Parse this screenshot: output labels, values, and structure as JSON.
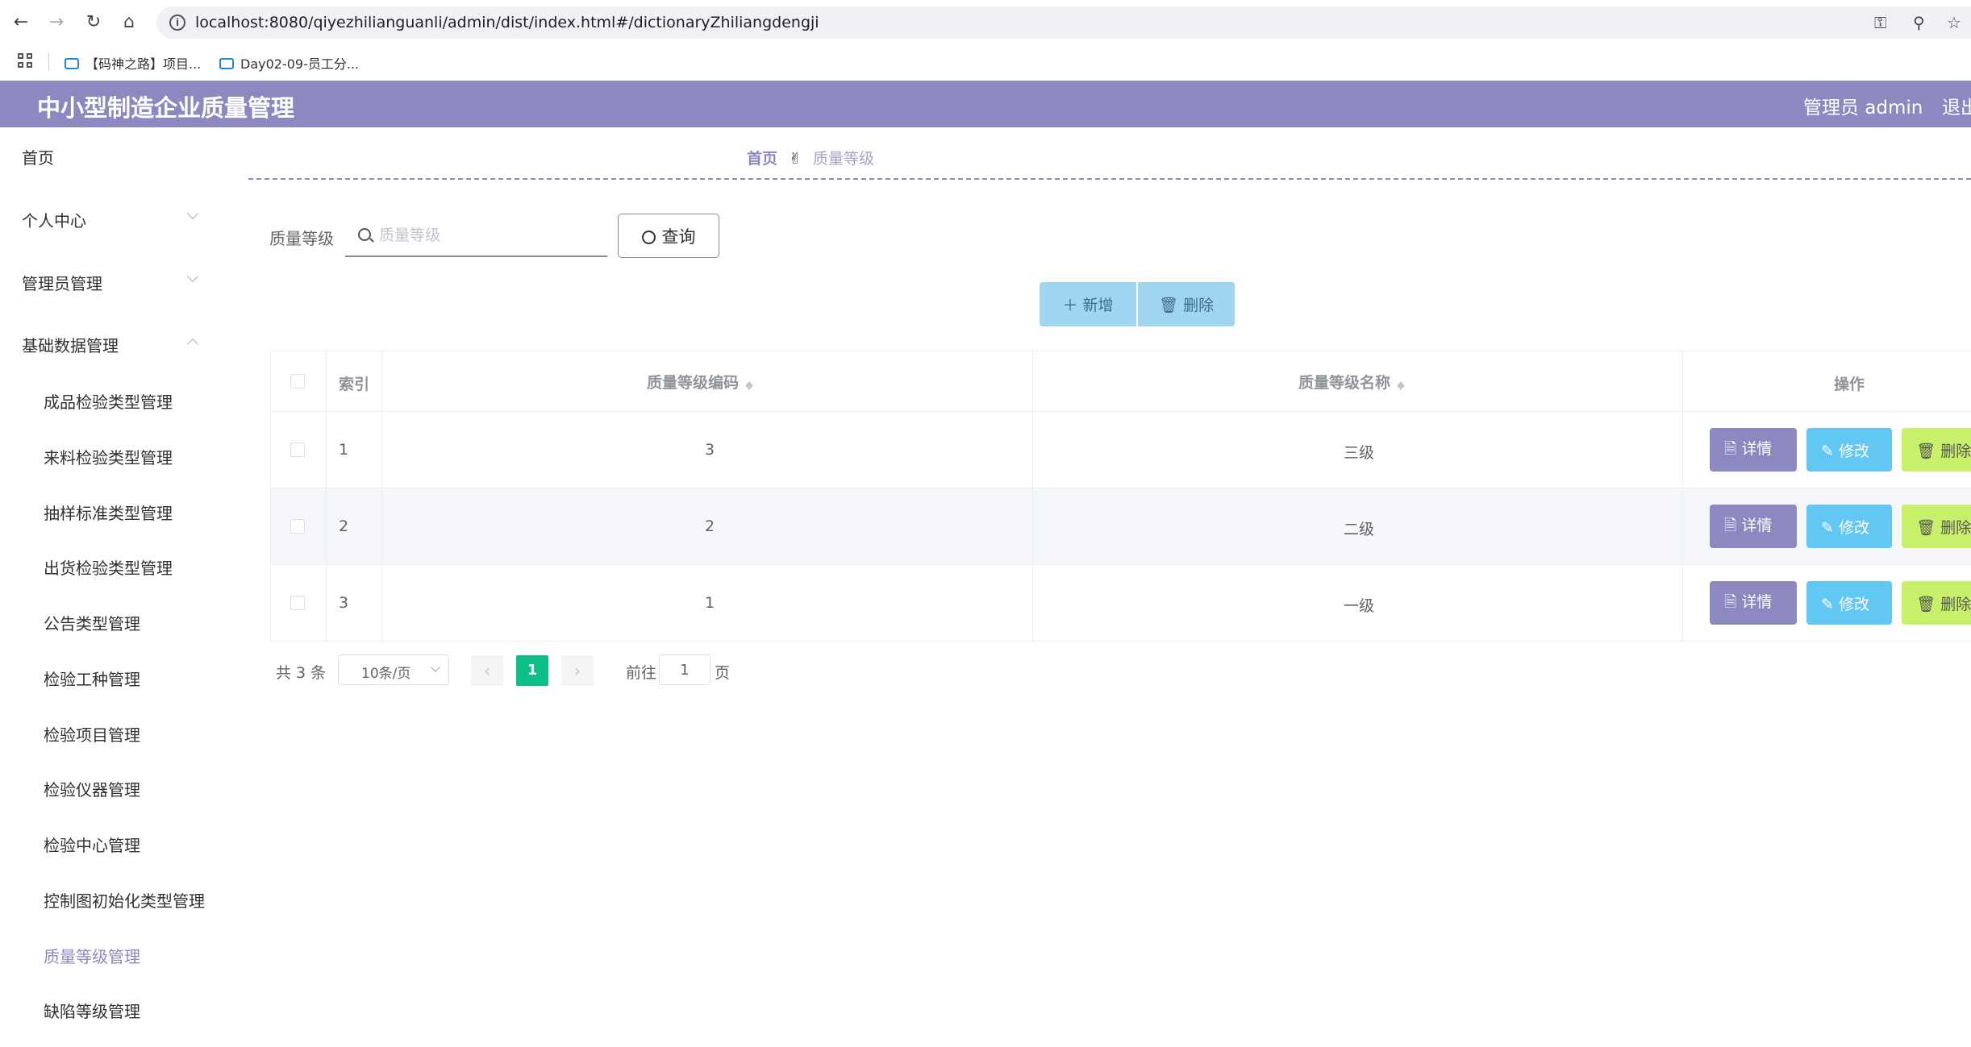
{
  "browser": {
    "url": "localhost:8080/qiyezhilianguanli/admin/dist/index.html#/dictionaryZhiliangdengji",
    "bookmarks": [
      "【码神之路】项目...",
      "Day02-09-员工分..."
    ]
  },
  "header": {
    "title": "中小型制造企业质量管理",
    "admin": "管理员 admin",
    "logout": "退出"
  },
  "sidebar": {
    "home": "首页",
    "groups": [
      {
        "label": "个人中心",
        "expanded": false
      },
      {
        "label": "管理员管理",
        "expanded": false
      },
      {
        "label": "基础数据管理",
        "expanded": true
      }
    ],
    "items": [
      "成品检验类型管理",
      "来料检验类型管理",
      "抽样标准类型管理",
      "出货检验类型管理",
      "公告类型管理",
      "检验工种管理",
      "检验项目管理",
      "检验仪器管理",
      "检验中心管理",
      "控制图初始化类型管理",
      "质量等级管理",
      "缺陷等级管理"
    ],
    "active_item": "质量等级管理"
  },
  "breadcrumb": {
    "home": "首页",
    "separator_icon": "hand-icon",
    "current": "质量等级"
  },
  "search": {
    "label": "质量等级",
    "placeholder": "质量等级",
    "value": "",
    "button": "查询"
  },
  "actions": {
    "add": "＋ 新增",
    "delete": "删除"
  },
  "table": {
    "columns": [
      "索引",
      "质量等级编码",
      "质量等级名称",
      "操作"
    ],
    "rows": [
      {
        "index": "1",
        "code": "3",
        "name": "三级"
      },
      {
        "index": "2",
        "code": "2",
        "name": "二级"
      },
      {
        "index": "3",
        "code": "1",
        "name": "一级"
      }
    ],
    "row_buttons": {
      "detail": "详情",
      "edit": "修改",
      "delete": "删除"
    }
  },
  "pagination": {
    "total": "共 3 条",
    "page_size": "10条/页",
    "current_page": "1",
    "goto_prefix": "前往",
    "goto_value": "1",
    "goto_suffix": "页"
  },
  "colors": {
    "theme": "#8b89c0",
    "detail": "#8b89c0",
    "edit": "#62c7f2",
    "delete": "#c9f06a",
    "pagination_active": "#0fbf8a",
    "toolbar_button": "#a0d6ef"
  }
}
